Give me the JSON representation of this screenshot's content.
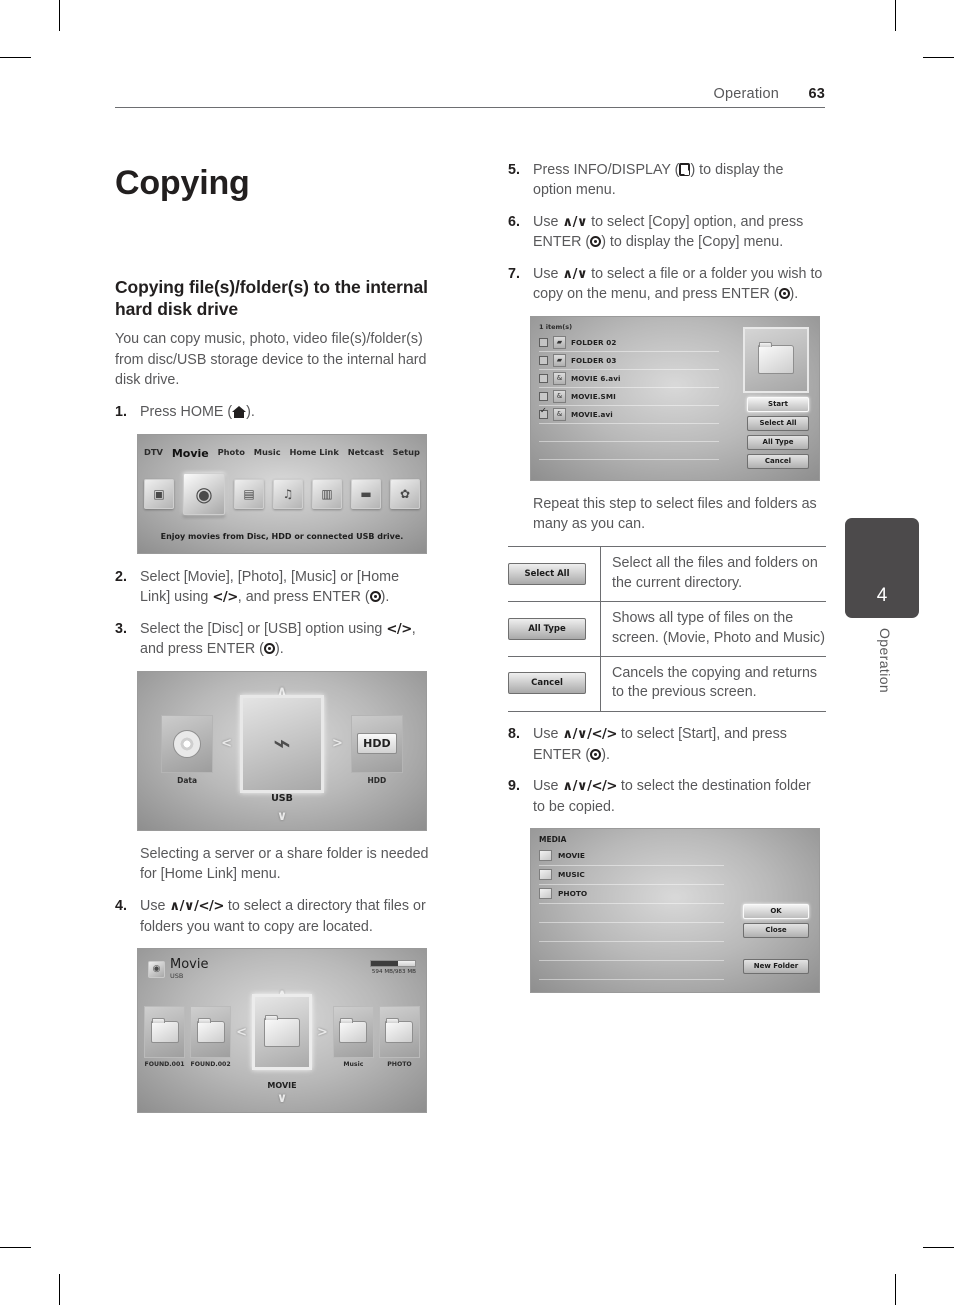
{
  "header": {
    "section": "Operation",
    "page_number": "63"
  },
  "side_tab": {
    "number": "4",
    "label": "Operation"
  },
  "left_column": {
    "chapter_title": "Copying",
    "section_title": "Copying file(s)/folder(s) to the internal hard disk drive",
    "intro": "You can copy music, photo, video file(s)/folder(s) from disc/USB storage device to the internal hard disk drive.",
    "steps": [
      {
        "num": "1.",
        "text_before": "Press HOME (",
        "icon": "home-icon",
        "text_after": ")."
      },
      {
        "num": "2.",
        "text_before": "Select [Movie], [Photo], [Music] or [Home Link] using ",
        "key": "</>",
        "text_mid": ", and press ENTER (",
        "icon": "enter-icon",
        "text_after": ")."
      },
      {
        "num": "3.",
        "text_before": "Select the [Disc] or [USB] option using ",
        "key": "</>",
        "text_mid": ", and press ENTER (",
        "icon": "enter-icon",
        "text_after": ")."
      },
      {
        "num": "4.",
        "text_before": "Use ",
        "key": "∧/∨/</>",
        "text_after": " to select a directory that files or folders you want to copy are located."
      }
    ],
    "note": "Selecting a server or a share folder is needed for [Home Link] menu.",
    "home_menu_shot": {
      "items": [
        {
          "label": "DTV",
          "icon": "tv-icon",
          "glyph": "▣",
          "selected": false
        },
        {
          "label": "Movie",
          "icon": "film-reel-icon",
          "glyph": "◉",
          "selected": true
        },
        {
          "label": "Photo",
          "icon": "photo-icon",
          "glyph": "▤",
          "selected": false
        },
        {
          "label": "Music",
          "icon": "music-note-icon",
          "glyph": "♫",
          "selected": false
        },
        {
          "label": "Home Link",
          "icon": "home-link-icon",
          "glyph": "▥",
          "selected": false
        },
        {
          "label": "Netcast",
          "icon": "netcast-icon",
          "glyph": "▬",
          "selected": false
        },
        {
          "label": "Setup",
          "icon": "gear-icon",
          "glyph": "✿",
          "selected": false
        }
      ],
      "caption": "Enjoy movies from Disc, HDD or connected USB drive."
    },
    "source_shot": {
      "left": {
        "label": "Data",
        "icon": "disc-icon"
      },
      "center": {
        "label": "USB",
        "icon": "usb-icon"
      },
      "right": {
        "label": "HDD",
        "icon": "hdd-icon"
      },
      "up_arrow": "∧",
      "down_arrow": "∨",
      "left_arrow": "<",
      "right_arrow": ">"
    },
    "browser_shot": {
      "title": "Movie",
      "subtitle": "USB",
      "capacity": "594 MB/983 MB",
      "folders": [
        {
          "label": "FOUND.001",
          "selected": false
        },
        {
          "label": "FOUND.002",
          "selected": false
        },
        {
          "label": "MOVIE",
          "selected": true
        },
        {
          "label": "Music",
          "selected": false
        },
        {
          "label": "PHOTO",
          "selected": false
        }
      ],
      "up_arrow": "∧",
      "down_arrow": "∨",
      "left_arrow": "<",
      "right_arrow": ">"
    }
  },
  "right_column": {
    "steps": [
      {
        "num": "5.",
        "text_before": "Press INFO/DISPLAY (",
        "icon": "info-display-icon",
        "text_after": ") to display the option menu."
      },
      {
        "num": "6.",
        "text_before": "Use ",
        "key": "∧/∨",
        "text_mid": " to select [Copy] option, and press ENTER (",
        "icon": "enter-icon",
        "text_after": ") to display the [Copy] menu."
      },
      {
        "num": "7.",
        "text_before": "Use ",
        "key": "∧/∨",
        "text_mid": " to select a file or a folder you wish to copy on the menu, and press ENTER (",
        "icon": "enter-icon",
        "text_after": ")."
      },
      {
        "num": "8.",
        "text_before": "Use ",
        "key": "∧/∨/</>",
        "text_mid": " to select [Start], and press ENTER (",
        "icon": "enter-icon",
        "text_after": ")."
      },
      {
        "num": "9.",
        "text_before": "Use ",
        "key": "∧/∨/</>",
        "text_after": " to select the destination folder to be copied."
      }
    ],
    "repeat_note": "Repeat this step to select files and folders as many as you can.",
    "copy_menu_shot": {
      "item_count_label": "1 item(s)",
      "files": [
        {
          "name": "FOLDER 02",
          "type": "folder-icon",
          "checked": false
        },
        {
          "name": "FOLDER 03",
          "type": "folder-icon",
          "checked": false
        },
        {
          "name": "MOVIE 6.avi",
          "type": "movie-file-icon",
          "checked": false
        },
        {
          "name": "MOVIE.SMI",
          "type": "movie-file-icon",
          "checked": false
        },
        {
          "name": "MOVIE.avi",
          "type": "movie-file-icon",
          "checked": true
        }
      ],
      "buttons": [
        {
          "label": "Start",
          "selected": true
        },
        {
          "label": "Select All",
          "selected": false
        },
        {
          "label": "All Type",
          "selected": false
        },
        {
          "label": "Cancel",
          "selected": false
        }
      ]
    },
    "button_table": [
      {
        "button": "Select All",
        "description": "Select all the files and folders on the current directory."
      },
      {
        "button": "All Type",
        "description": "Shows all type of files on the screen. (Movie, Photo and Music)"
      },
      {
        "button": "Cancel",
        "description": "Cancels the copying and returns to the previous screen."
      }
    ],
    "destination_shot": {
      "header": "MEDIA",
      "folders": [
        "MOVIE",
        "MUSIC",
        "PHOTO"
      ],
      "buttons": [
        {
          "label": "OK",
          "selected": true
        },
        {
          "label": "Close",
          "selected": false
        },
        {
          "label": "New Folder",
          "selected": false
        }
      ]
    }
  }
}
